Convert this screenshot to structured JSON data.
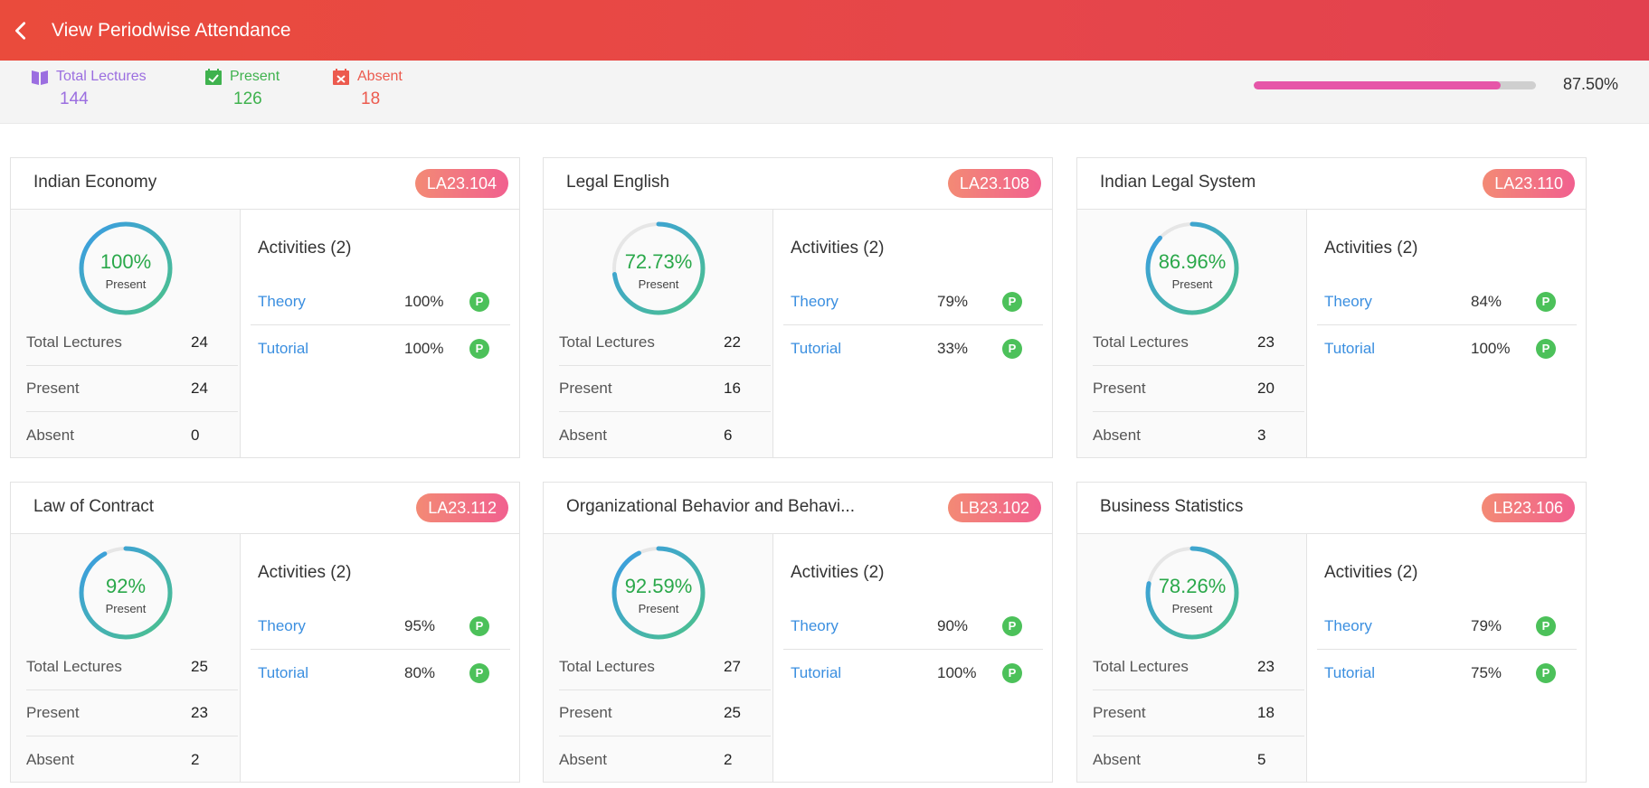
{
  "header": {
    "title": "View Periodwise Attendance"
  },
  "summary": {
    "total_label": "Total Lectures",
    "total_value": "144",
    "present_label": "Present",
    "present_value": "126",
    "absent_label": "Absent",
    "absent_value": "18",
    "progress_percent_text": "87.50%",
    "progress_fraction": 0.875
  },
  "labels": {
    "present": "Present",
    "total_lectures": "Total Lectures",
    "present_row": "Present",
    "absent_row": "Absent",
    "badge": "P"
  },
  "colors": {
    "accent_red": "#e6464a",
    "present_green": "#3fb24e",
    "absent_red": "#ec5a4e",
    "total_purple": "#9b6ee0",
    "progress_pink": "#e655a8",
    "link_blue": "#3b8fe0"
  },
  "courses": [
    {
      "name": "Indian Economy",
      "code": "LA23.104",
      "percent_text": "100%",
      "percent": 100,
      "total": "24",
      "present": "24",
      "absent": "0",
      "activities_title": "Activities (2)",
      "activities": [
        {
          "name": "Theory",
          "percent": "100%"
        },
        {
          "name": "Tutorial",
          "percent": "100%"
        }
      ]
    },
    {
      "name": "Legal English",
      "code": "LA23.108",
      "percent_text": "72.73%",
      "percent": 72.73,
      "total": "22",
      "present": "16",
      "absent": "6",
      "activities_title": "Activities (2)",
      "activities": [
        {
          "name": "Theory",
          "percent": "79%"
        },
        {
          "name": "Tutorial",
          "percent": "33%"
        }
      ]
    },
    {
      "name": "Indian Legal System",
      "code": "LA23.110",
      "percent_text": "86.96%",
      "percent": 86.96,
      "total": "23",
      "present": "20",
      "absent": "3",
      "activities_title": "Activities (2)",
      "activities": [
        {
          "name": "Theory",
          "percent": "84%"
        },
        {
          "name": "Tutorial",
          "percent": "100%"
        }
      ]
    },
    {
      "name": "Law of Contract",
      "code": "LA23.112",
      "percent_text": "92%",
      "percent": 92,
      "total": "25",
      "present": "23",
      "absent": "2",
      "activities_title": "Activities (2)",
      "activities": [
        {
          "name": "Theory",
          "percent": "95%"
        },
        {
          "name": "Tutorial",
          "percent": "80%"
        }
      ]
    },
    {
      "name": "Organizational Behavior and Behavi...",
      "code": "LB23.102",
      "percent_text": "92.59%",
      "percent": 92.59,
      "total": "27",
      "present": "25",
      "absent": "2",
      "activities_title": "Activities (2)",
      "activities": [
        {
          "name": "Theory",
          "percent": "90%"
        },
        {
          "name": "Tutorial",
          "percent": "100%"
        }
      ]
    },
    {
      "name": "Business Statistics",
      "code": "LB23.106",
      "percent_text": "78.26%",
      "percent": 78.26,
      "total": "23",
      "present": "18",
      "absent": "5",
      "activities_title": "Activities (2)",
      "activities": [
        {
          "name": "Theory",
          "percent": "79%"
        },
        {
          "name": "Tutorial",
          "percent": "75%"
        }
      ]
    }
  ]
}
